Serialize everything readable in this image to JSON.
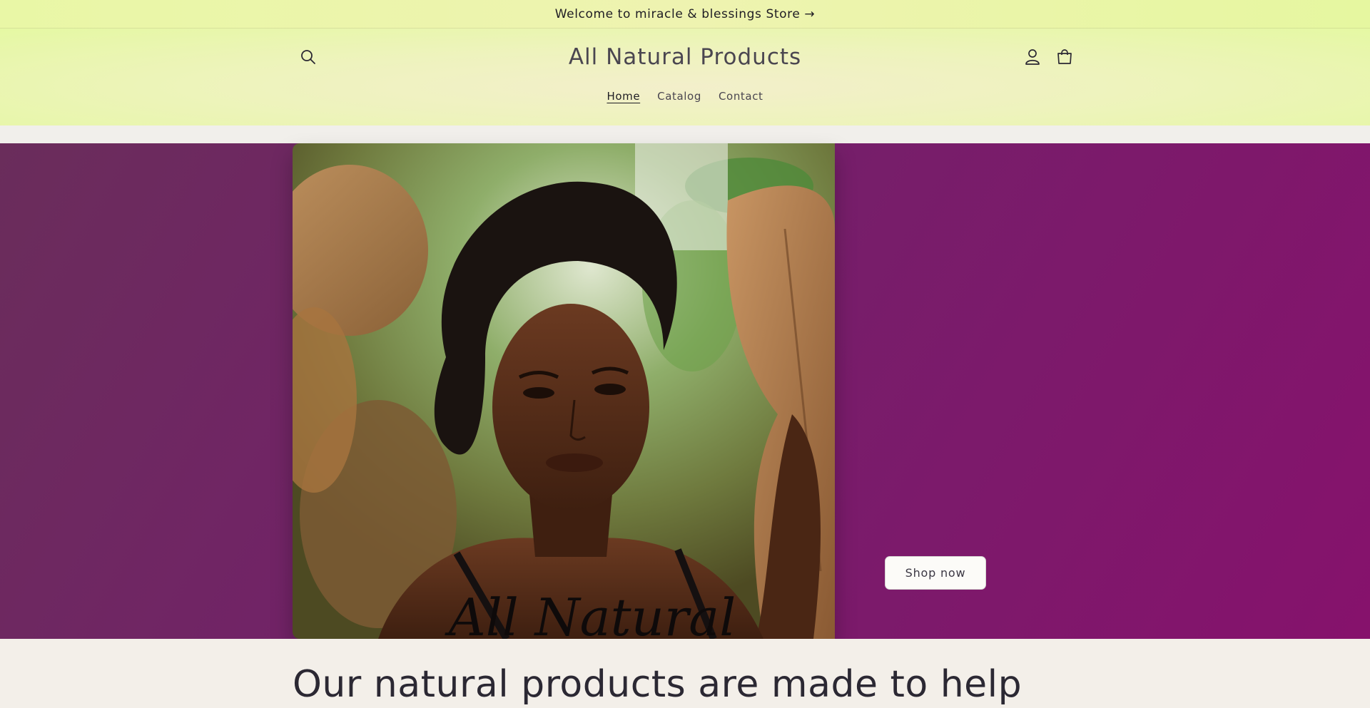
{
  "announcement": {
    "text": "Welcome to miracle & blessings Store",
    "arrow": "→"
  },
  "header": {
    "logo_text": "All Natural Products",
    "search_icon": "search-icon",
    "account_icon": "account-icon",
    "cart_icon": "cart-icon"
  },
  "nav": {
    "items": [
      {
        "label": "Home",
        "active": true
      },
      {
        "label": "Catalog",
        "active": false
      },
      {
        "label": "Contact",
        "active": false
      }
    ]
  },
  "hero": {
    "image_overlay_text": "All Natural",
    "button_label": "Shop now",
    "background_colors": [
      "#6a2d5b",
      "#86126c"
    ]
  },
  "section": {
    "heading": "Our natural products are made to help"
  },
  "colors": {
    "announcement_bg": "#e9f7a6",
    "header_bg": "#eef3bd",
    "hero_bg": "#7a1d68",
    "text": "#2b2833"
  }
}
